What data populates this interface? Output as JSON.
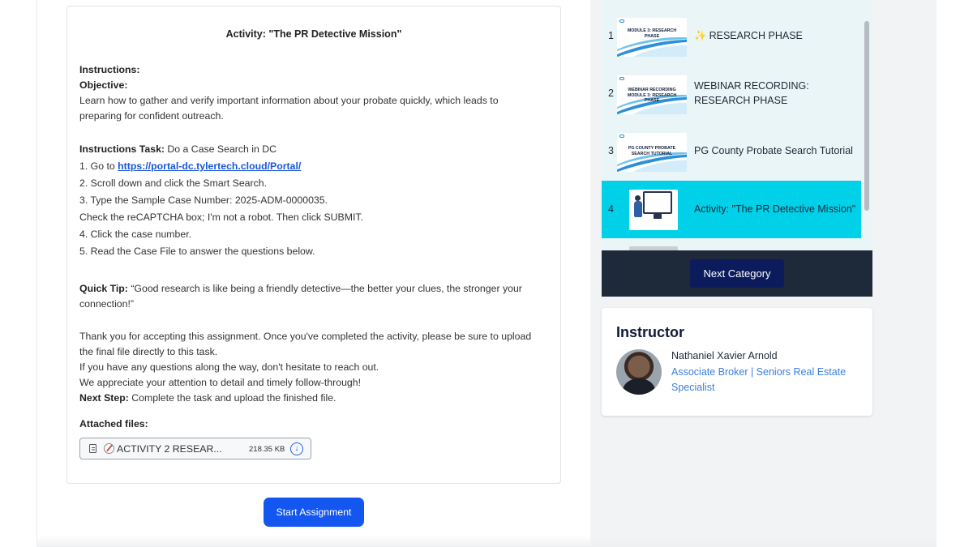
{
  "activity": {
    "title": "Activity: \"The PR Detective Mission\"",
    "instructions_heading": "Instructions:",
    "objective_label": "Objective:",
    "objective_line1": "Learn how to gather and verify important information about your probate quickly, which leads to",
    "objective_line2": "preparing for confident outreach.",
    "task_label": "Instructions Task:",
    "task_text": " Do a Case Search in DC",
    "step1_prefix": "1. Go to ",
    "step1_link": "https://portal-dc.tylertech.cloud/Portal/",
    "step2": "2. Scroll down and click the Smart Search.",
    "step3": "3. Type the Sample Case Number: 2025-ADM-0000035.",
    "step3b": "Check the reCAPTCHA box; I'm not a robot. Then click SUBMIT.",
    "step4": "4. Click the case number.",
    "step5": "5. Read the Case File to answer the questions below.",
    "tip_label": "Quick Tip:",
    "tip_line1": " “Good research is like being a friendly detective—the better your clues, the stronger your",
    "tip_line2": "connection!”",
    "thanks_line1": "Thank you for accepting this assignment. Once you've completed the activity, please be sure to upload",
    "thanks_line2": "the final file directly to this task.",
    "thanks_line3": "If you have any questions along the way, don't hesitate to reach out.",
    "thanks_line4": "We appreciate your attention to detail and timely follow-through!",
    "next_step_label": "Next Step:",
    "next_step_text": " Complete the task and upload the finished file.",
    "attached_label": "Attached files:",
    "file": {
      "name": "ACTIVITY 2 RESEAR...",
      "size": "218.35 KB"
    },
    "start_button": "Start Assignment"
  },
  "modules": [
    {
      "num": "1",
      "label": "RESEARCH PHASE",
      "sparkle": "✨",
      "thumb_text": "MODULE 3: RESEARCH PHASE"
    },
    {
      "num": "2",
      "label": "WEBINAR RECORDING: RESEARCH PHASE",
      "thumb_text": "WEBINAR RECORDING MODULE 3: RESEARCH PHASE"
    },
    {
      "num": "3",
      "label": "PG County Probate Search Tutorial",
      "thumb_text": "PG COUNTY PROBATE SEARCH TUTORIAL"
    },
    {
      "num": "4",
      "label": "Activity: \"The PR Detective Mission\"",
      "active": true
    }
  ],
  "next_category": "Next Category",
  "instructor": {
    "heading": "Instructor",
    "name": "Nathaniel Xavier Arnold",
    "role": "Associate Broker | Seniors Real Estate Specialist"
  },
  "colors": {
    "accent": "#1457f0",
    "active_item": "#00d0e8",
    "next_bar": "#1e2a3a",
    "next_button": "#0c1b5c",
    "link": "#1a56db",
    "instructor_role": "#3a7fe0"
  }
}
